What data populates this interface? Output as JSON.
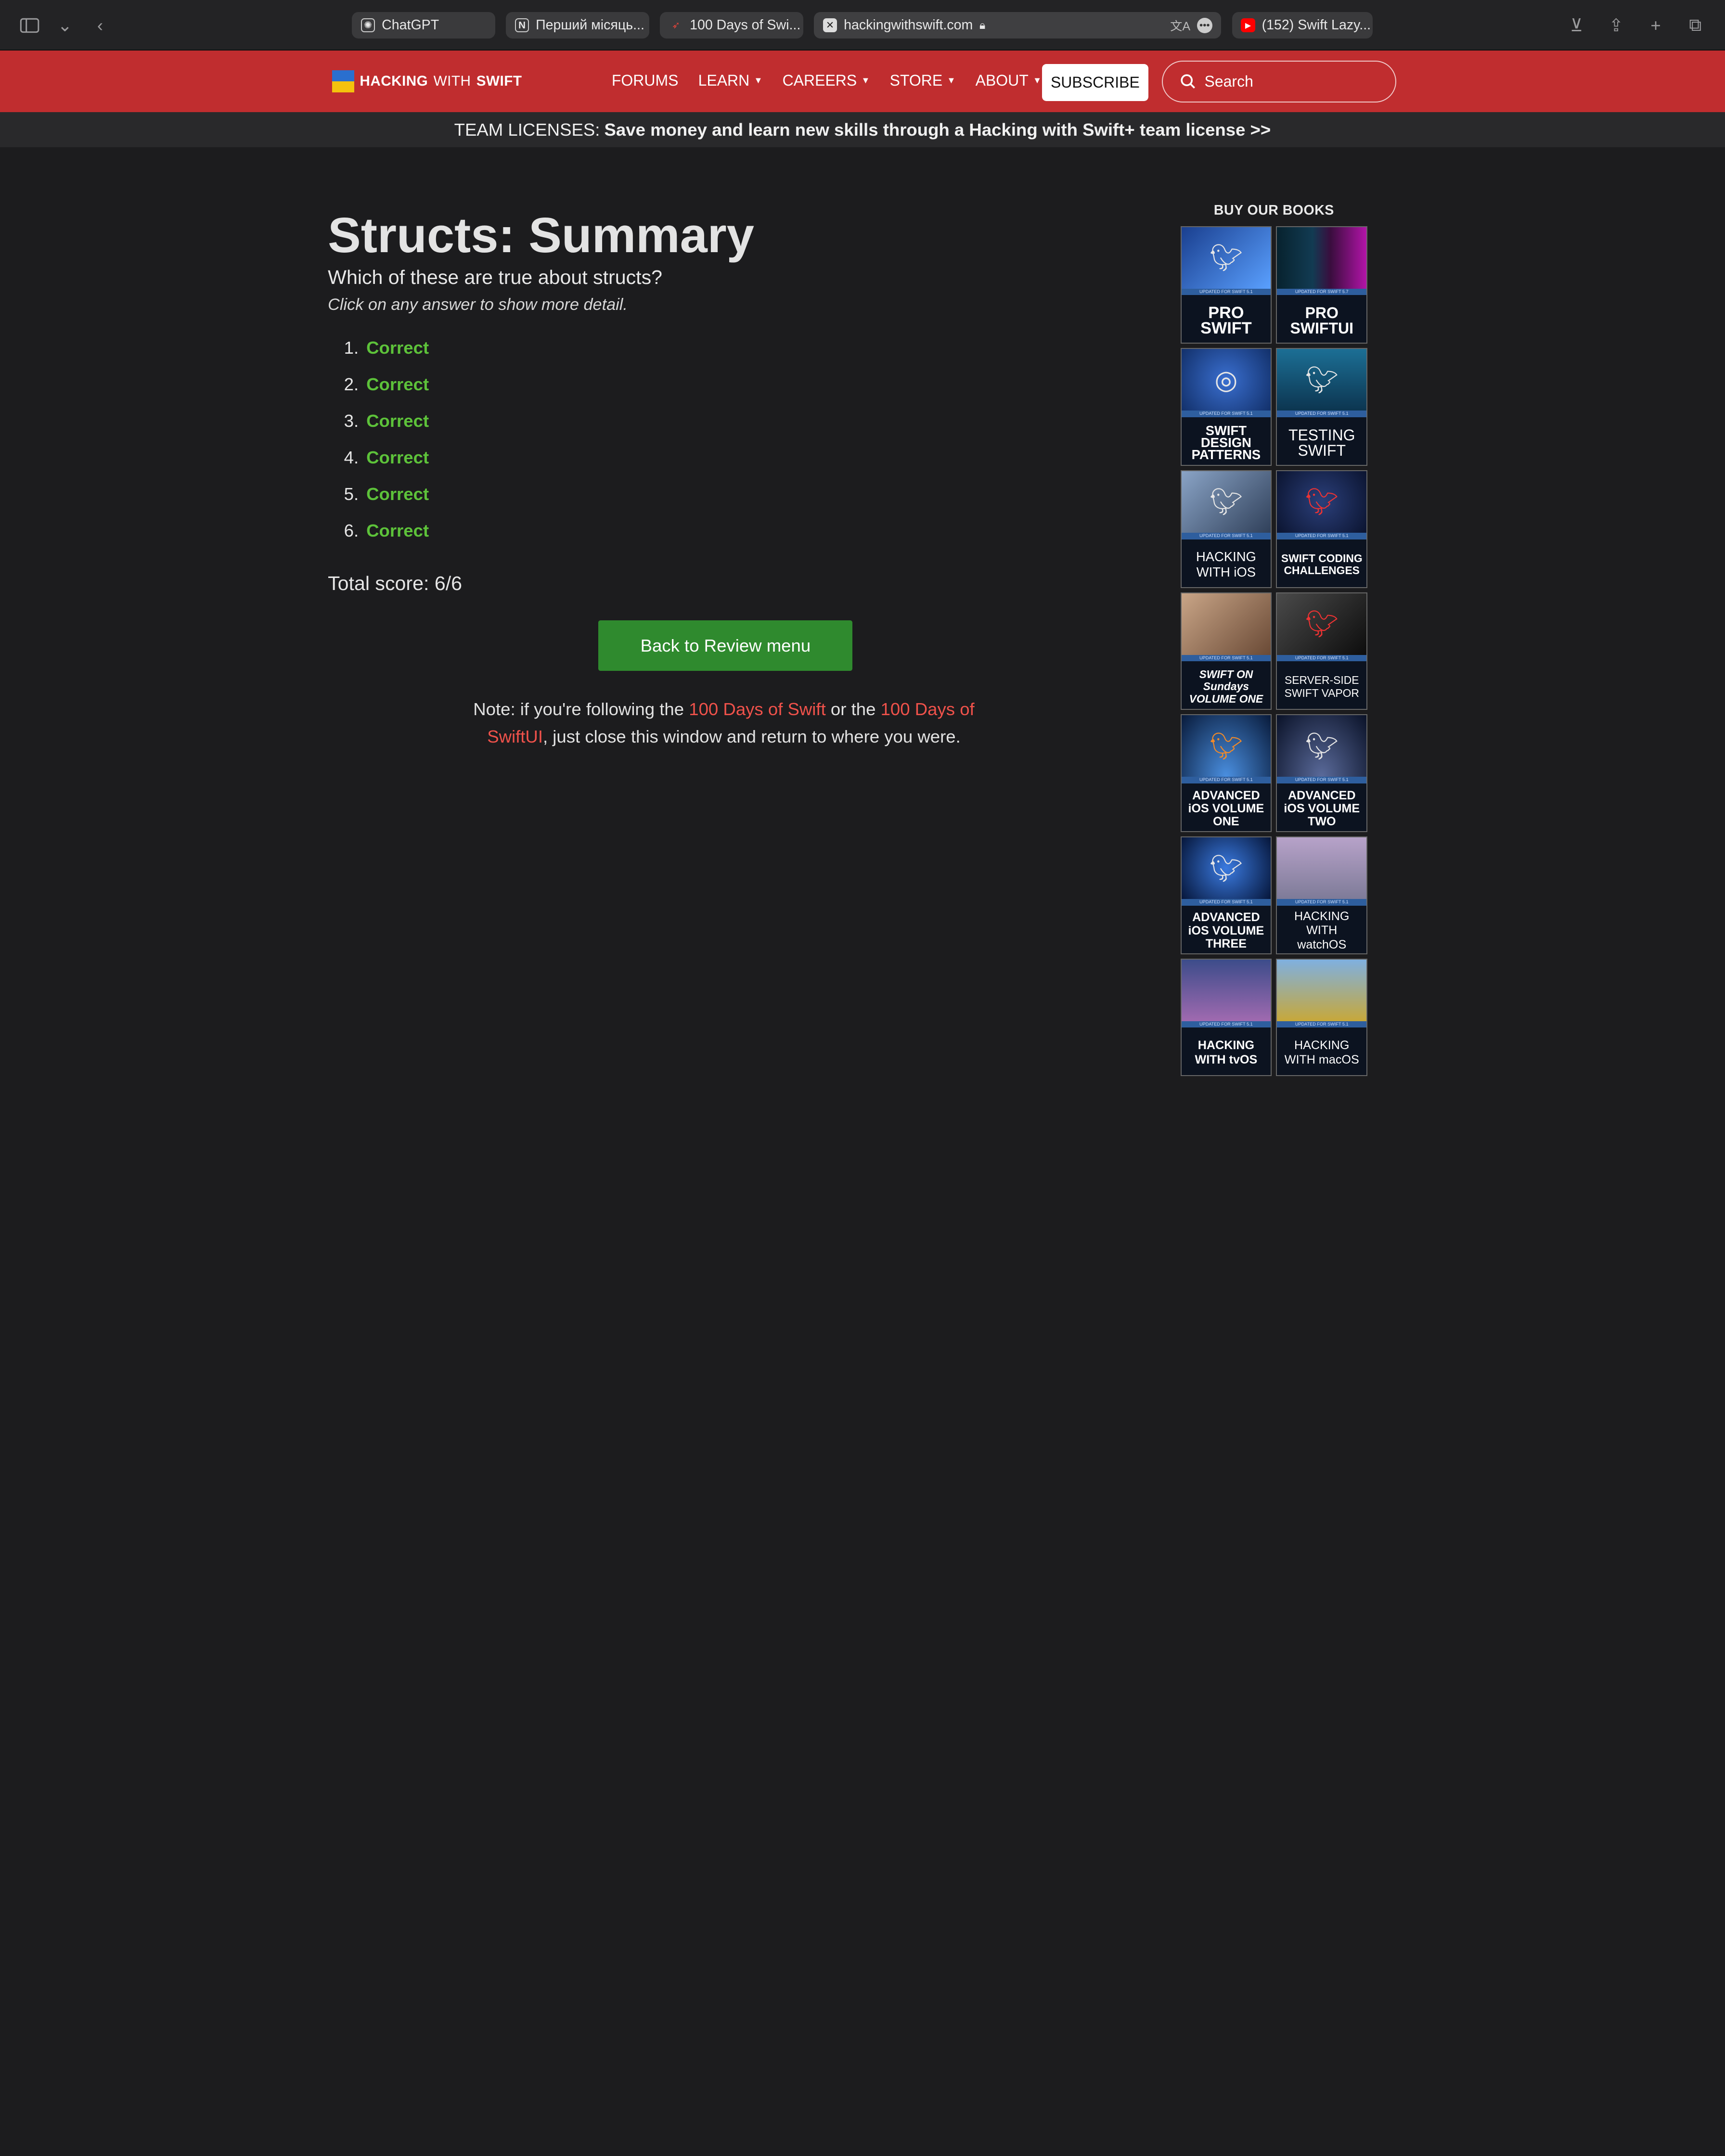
{
  "browser": {
    "tabs": [
      {
        "title": "ChatGPT",
        "icon": "chatgpt-icon",
        "color": "#e8e8e8"
      },
      {
        "title": "Перший місяць...",
        "icon": "notion-icon",
        "color": "#e8e8e8"
      },
      {
        "title": "100 Days of Swi...",
        "icon": "swift-bird-icon",
        "color": "#e0443a"
      },
      {
        "title": "hackingwithswift.com",
        "icon": "close-icon",
        "color": "#e8e8e8"
      },
      {
        "title": "(152) Swift Lazy...",
        "icon": "youtube-icon",
        "color": "#ff0000"
      }
    ]
  },
  "header": {
    "logo_bold1": "HACKING",
    "logo_with": "WITH",
    "logo_bold2": "SWIFT",
    "nav": [
      "FORUMS",
      "LEARN",
      "CAREERS",
      "STORE",
      "ABOUT"
    ],
    "nav_has_caret": [
      false,
      true,
      true,
      true,
      true
    ],
    "subscribe": "SUBSCRIBE",
    "search_placeholder": "Search",
    "brand_color": "#c02d2f"
  },
  "banner": {
    "prefix": "TEAM LICENSES:",
    "text": "Save money and learn new skills through a Hacking with Swift+ team license >>"
  },
  "main": {
    "title": "Structs: Summary",
    "question": "Which of these are true about structs?",
    "hint": "Click on any answer to show more detail.",
    "answers": [
      {
        "num": "1.",
        "label": "Correct"
      },
      {
        "num": "2.",
        "label": "Correct"
      },
      {
        "num": "3.",
        "label": "Correct"
      },
      {
        "num": "4.",
        "label": "Correct"
      },
      {
        "num": "5.",
        "label": "Correct"
      },
      {
        "num": "6.",
        "label": "Correct"
      }
    ],
    "total": "Total score: 6/6",
    "back_button": "Back to Review menu",
    "note_1": "Note: if you're following the ",
    "note_link1": "100 Days of Swift",
    "note_2": " or the ",
    "note_link2": "100 Days of SwiftUI",
    "note_3": ", just close this window and return to where you were."
  },
  "sidebar": {
    "title": "BUY OUR BOOKS",
    "books": [
      {
        "title": "PRO SWIFT",
        "strip": "UPDATED FOR SWIFT 5.1"
      },
      {
        "title": "PRO SWIFTUI",
        "strip": "UPDATED FOR SWIFT 5.7"
      },
      {
        "title": "SWIFT DESIGN PATTERNS",
        "strip": "UPDATED FOR SWIFT 5.1"
      },
      {
        "title": "TESTING SWIFT",
        "strip": "UPDATED FOR SWIFT 5.1"
      },
      {
        "title": "HACKING WITH iOS",
        "strip": "UPDATED FOR SWIFT 5.1"
      },
      {
        "title": "SWIFT CODING CHALLENGES",
        "strip": "UPDATED FOR SWIFT 5.1"
      },
      {
        "title": "SWIFT ON Sundays VOLUME ONE",
        "strip": "UPDATED FOR SWIFT 5.1"
      },
      {
        "title": "SERVER-SIDE SWIFT VAPOR",
        "strip": "UPDATED FOR SWIFT 5.1"
      },
      {
        "title": "ADVANCED iOS VOLUME ONE",
        "strip": "UPDATED FOR SWIFT 5.1"
      },
      {
        "title": "ADVANCED iOS VOLUME TWO",
        "strip": "UPDATED FOR SWIFT 5.1"
      },
      {
        "title": "ADVANCED iOS VOLUME THREE",
        "strip": "UPDATED FOR SWIFT 5.1"
      },
      {
        "title": "HACKING WITH watchOS",
        "strip": "UPDATED FOR SWIFT 5.1"
      },
      {
        "title": "HACKING WITH tvOS",
        "strip": "UPDATED FOR SWIFT 5.1"
      },
      {
        "title": "HACKING WITH macOS",
        "strip": "UPDATED FOR SWIFT 5.1"
      }
    ]
  }
}
